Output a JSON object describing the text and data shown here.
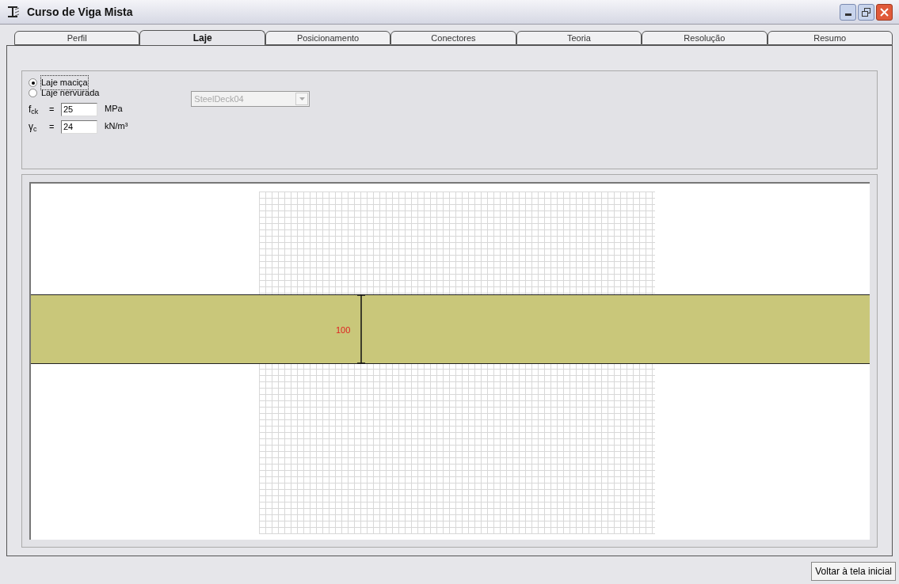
{
  "window": {
    "title": "Curso de Viga Mista"
  },
  "tabs": [
    {
      "label": "Perfil",
      "selected": false
    },
    {
      "label": "Laje",
      "selected": true
    },
    {
      "label": "Posicionamento",
      "selected": false
    },
    {
      "label": "Conectores",
      "selected": false
    },
    {
      "label": "Teoria",
      "selected": false
    },
    {
      "label": "Resolução",
      "selected": false
    },
    {
      "label": "Resumo",
      "selected": false
    }
  ],
  "slab_types": [
    {
      "label": "Laje maciça",
      "selected": true
    },
    {
      "label": "Laje nervurada",
      "selected": false
    }
  ],
  "deck_dropdown": {
    "value": "SteelDeck04",
    "disabled": true
  },
  "parameters": [
    {
      "symbol": "f$_{ck}$",
      "relation": "=",
      "value": "25",
      "unit": "MPa"
    },
    {
      "symbol": "γ$_{c}$",
      "relation": "=",
      "value": "24",
      "unit": "kN/m³"
    }
  ],
  "drawing": {
    "dimension": "100"
  },
  "back_button": "Voltar à tela inicial"
}
